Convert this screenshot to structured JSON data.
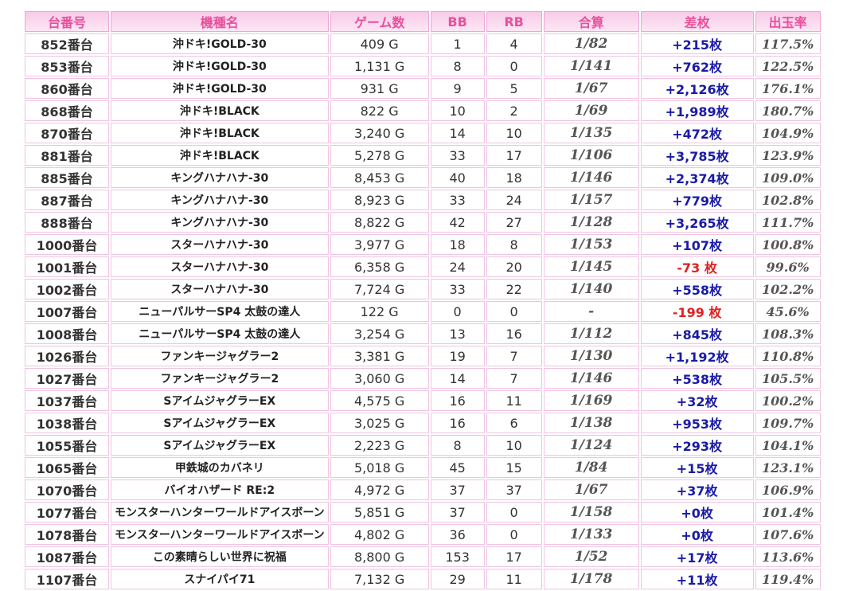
{
  "headers": [
    "台番号",
    "機種名",
    "ゲーム数",
    "BB",
    "RB",
    "合算",
    "差枚",
    "出玉率"
  ],
  "rows": [
    {
      "unit": "852番台",
      "model": "沖ドキ!GOLD-30",
      "games": "409 G",
      "bb": "1",
      "rb": "4",
      "ratio": "1/82",
      "diff": "+215枚",
      "payout": "117.5%",
      "neg": false
    },
    {
      "unit": "853番台",
      "model": "沖ドキ!GOLD-30",
      "games": "1,131 G",
      "bb": "8",
      "rb": "0",
      "ratio": "1/141",
      "diff": "+762枚",
      "payout": "122.5%",
      "neg": false
    },
    {
      "unit": "860番台",
      "model": "沖ドキ!GOLD-30",
      "games": "931 G",
      "bb": "9",
      "rb": "5",
      "ratio": "1/67",
      "diff": "+2,126枚",
      "payout": "176.1%",
      "neg": false
    },
    {
      "unit": "868番台",
      "model": "沖ドキ!BLACK",
      "games": "822 G",
      "bb": "10",
      "rb": "2",
      "ratio": "1/69",
      "diff": "+1,989枚",
      "payout": "180.7%",
      "neg": false
    },
    {
      "unit": "870番台",
      "model": "沖ドキ!BLACK",
      "games": "3,240 G",
      "bb": "14",
      "rb": "10",
      "ratio": "1/135",
      "diff": "+472枚",
      "payout": "104.9%",
      "neg": false
    },
    {
      "unit": "881番台",
      "model": "沖ドキ!BLACK",
      "games": "5,278 G",
      "bb": "33",
      "rb": "17",
      "ratio": "1/106",
      "diff": "+3,785枚",
      "payout": "123.9%",
      "neg": false
    },
    {
      "unit": "885番台",
      "model": "キングハナハナ-30",
      "games": "8,453 G",
      "bb": "40",
      "rb": "18",
      "ratio": "1/146",
      "diff": "+2,374枚",
      "payout": "109.0%",
      "neg": false
    },
    {
      "unit": "887番台",
      "model": "キングハナハナ-30",
      "games": "8,923 G",
      "bb": "33",
      "rb": "24",
      "ratio": "1/157",
      "diff": "+779枚",
      "payout": "102.8%",
      "neg": false
    },
    {
      "unit": "888番台",
      "model": "キングハナハナ-30",
      "games": "8,822 G",
      "bb": "42",
      "rb": "27",
      "ratio": "1/128",
      "diff": "+3,265枚",
      "payout": "111.7%",
      "neg": false
    },
    {
      "unit": "1000番台",
      "model": "スターハナハナ-30",
      "games": "3,977 G",
      "bb": "18",
      "rb": "8",
      "ratio": "1/153",
      "diff": "+107枚",
      "payout": "100.8%",
      "neg": false
    },
    {
      "unit": "1001番台",
      "model": "スターハナハナ-30",
      "games": "6,358 G",
      "bb": "24",
      "rb": "20",
      "ratio": "1/145",
      "diff": "-73 枚",
      "payout": "99.6%",
      "neg": true
    },
    {
      "unit": "1002番台",
      "model": "スターハナハナ-30",
      "games": "7,724 G",
      "bb": "33",
      "rb": "22",
      "ratio": "1/140",
      "diff": "+558枚",
      "payout": "102.2%",
      "neg": false
    },
    {
      "unit": "1007番台",
      "model": "ニューパルサーSP4 太鼓の達人",
      "games": "122 G",
      "bb": "0",
      "rb": "0",
      "ratio": "-",
      "diff": "-199 枚",
      "payout": "45.6%",
      "neg": true
    },
    {
      "unit": "1008番台",
      "model": "ニューパルサーSP4 太鼓の達人",
      "games": "3,254 G",
      "bb": "13",
      "rb": "16",
      "ratio": "1/112",
      "diff": "+845枚",
      "payout": "108.3%",
      "neg": false
    },
    {
      "unit": "1026番台",
      "model": "ファンキージャグラー2",
      "games": "3,381 G",
      "bb": "19",
      "rb": "7",
      "ratio": "1/130",
      "diff": "+1,192枚",
      "payout": "110.8%",
      "neg": false
    },
    {
      "unit": "1027番台",
      "model": "ファンキージャグラー2",
      "games": "3,060 G",
      "bb": "14",
      "rb": "7",
      "ratio": "1/146",
      "diff": "+538枚",
      "payout": "105.5%",
      "neg": false
    },
    {
      "unit": "1037番台",
      "model": "SアイムジャグラーEX",
      "games": "4,575 G",
      "bb": "16",
      "rb": "11",
      "ratio": "1/169",
      "diff": "+32枚",
      "payout": "100.2%",
      "neg": false
    },
    {
      "unit": "1038番台",
      "model": "SアイムジャグラーEX",
      "games": "3,025 G",
      "bb": "16",
      "rb": "6",
      "ratio": "1/138",
      "diff": "+953枚",
      "payout": "109.7%",
      "neg": false
    },
    {
      "unit": "1055番台",
      "model": "SアイムジャグラーEX",
      "games": "2,223 G",
      "bb": "8",
      "rb": "10",
      "ratio": "1/124",
      "diff": "+293枚",
      "payout": "104.1%",
      "neg": false
    },
    {
      "unit": "1065番台",
      "model": "甲鉄城のカバネリ",
      "games": "5,018 G",
      "bb": "45",
      "rb": "15",
      "ratio": "1/84",
      "diff": "+15枚",
      "payout": "123.1%",
      "neg": false
    },
    {
      "unit": "1070番台",
      "model": "バイオハザード RE:2",
      "games": "4,972 G",
      "bb": "37",
      "rb": "37",
      "ratio": "1/67",
      "diff": "+37枚",
      "payout": "106.9%",
      "neg": false
    },
    {
      "unit": "1077番台",
      "model": "モンスターハンターワールドアイスボーン",
      "games": "5,851 G",
      "bb": "37",
      "rb": "0",
      "ratio": "1/158",
      "diff": "+0枚",
      "payout": "101.4%",
      "neg": false
    },
    {
      "unit": "1078番台",
      "model": "モンスターハンターワールドアイスボーン",
      "games": "4,802 G",
      "bb": "36",
      "rb": "0",
      "ratio": "1/133",
      "diff": "+0枚",
      "payout": "107.6%",
      "neg": false
    },
    {
      "unit": "1087番台",
      "model": "この素晴らしい世界に祝福",
      "games": "8,800 G",
      "bb": "153",
      "rb": "17",
      "ratio": "1/52",
      "diff": "+17枚",
      "payout": "113.6%",
      "neg": false
    },
    {
      "unit": "1107番台",
      "model": "スナイパイ71",
      "games": "7,132 G",
      "bb": "29",
      "rb": "11",
      "ratio": "1/178",
      "diff": "+11枚",
      "payout": "119.4%",
      "neg": false
    }
  ]
}
